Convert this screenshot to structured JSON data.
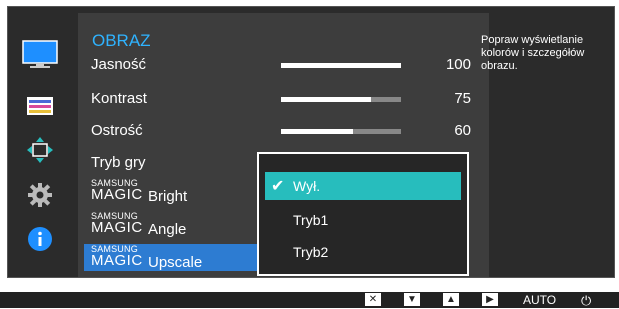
{
  "menu": {
    "title": "OBRAZ",
    "items": [
      {
        "label": "Jasność",
        "value": "100",
        "fill": 1.0
      },
      {
        "label": "Kontrast",
        "value": "75",
        "fill": 0.75
      },
      {
        "label": "Ostrość",
        "value": "60",
        "fill": 0.6
      },
      {
        "label": "Tryb gry"
      },
      {
        "brand_top": "SAMSUNG",
        "brand_big": "MAGIC",
        "label": "Bright"
      },
      {
        "brand_top": "SAMSUNG",
        "brand_big": "MAGIC",
        "label": "Angle"
      },
      {
        "brand_top": "SAMSUNG",
        "brand_big": "MAGIC",
        "label": "Upscale"
      }
    ]
  },
  "popup": {
    "options": [
      {
        "label": "Wył.",
        "selected": true
      },
      {
        "label": "Tryb1",
        "selected": false
      },
      {
        "label": "Tryb2",
        "selected": false
      }
    ]
  },
  "help_text": "Popraw wyświetlanie kolorów i szczegółów obrazu.",
  "bottom_bar": {
    "icons": [
      "close-icon",
      "down-icon",
      "up-icon",
      "right-icon"
    ],
    "auto_label": "AUTO",
    "power_icon": "power-icon"
  },
  "colors": {
    "accent_title": "#2fb3ff",
    "highlight": "#2d7cd2",
    "selected_option": "#27bdbd"
  }
}
